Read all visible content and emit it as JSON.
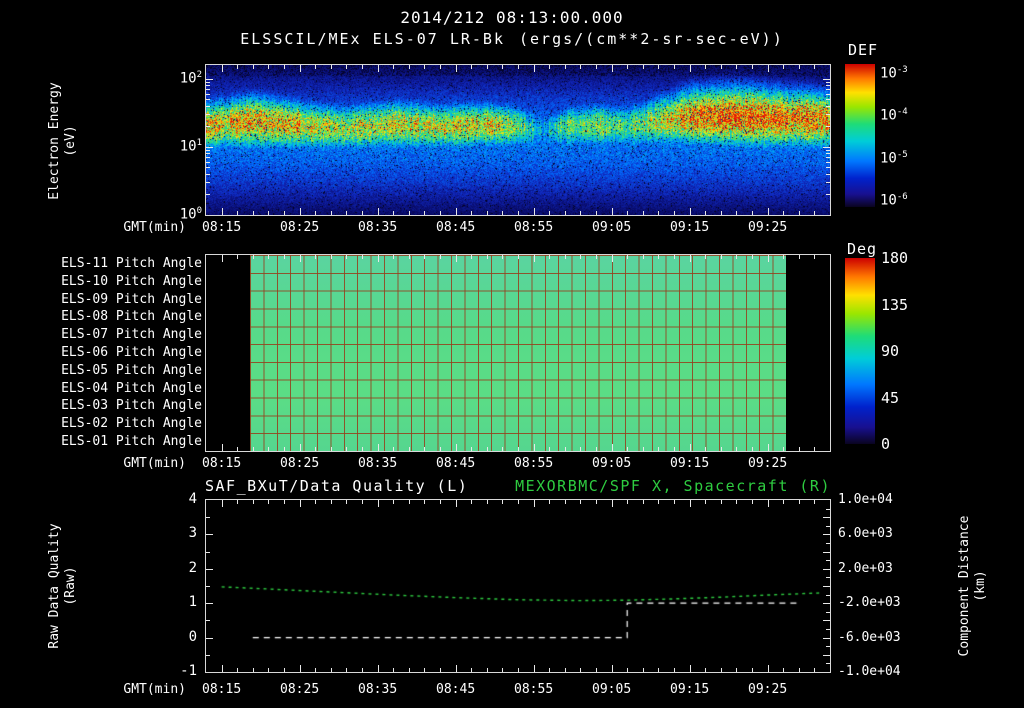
{
  "header": {
    "datetime": "2014/212 08:13:00.000",
    "instrument": "ELSSCIL/MEx ELS-07 LR-Bk",
    "units": "(ergs/(cm**2-sr-sec-eV))"
  },
  "time_axis": {
    "label": "GMT(min)",
    "start": "08:13:00",
    "range_minutes": [
      0,
      80
    ],
    "ticks": [
      {
        "label": "08:15",
        "minute": 2
      },
      {
        "label": "08:25",
        "minute": 12
      },
      {
        "label": "08:35",
        "minute": 22
      },
      {
        "label": "08:45",
        "minute": 32
      },
      {
        "label": "08:55",
        "minute": 42
      },
      {
        "label": "09:05",
        "minute": 52
      },
      {
        "label": "09:15",
        "minute": 62
      },
      {
        "label": "09:25",
        "minute": 72
      }
    ]
  },
  "colors": {
    "background": "#000000",
    "text": "#ffffff",
    "frame": "#d8d8d8",
    "series_green": "#2ecc40",
    "series_white": "#ffffff",
    "pitch_fill": "#57da8a",
    "pitch_grid": "#963e1c"
  },
  "chart_data": [
    {
      "type": "heatmap",
      "name": "electron-energy-spectrogram",
      "title": "ELSSCIL/MEx ELS-07 LR-Bk",
      "units": "ergs/(cm**2-sr-sec-eV)",
      "ylabel": [
        "Electron Energy",
        "(eV)"
      ],
      "y_scale": "log",
      "y_range_eV": [
        1,
        158
      ],
      "y_ticks": [
        {
          "mant": "10",
          "exp": "2"
        },
        {
          "mant": "10",
          "exp": "1"
        },
        {
          "mant": "10",
          "exp": "0"
        }
      ],
      "colorbar": {
        "title": "DEF",
        "min": 1e-06,
        "max": 0.001,
        "ticks": [
          {
            "mant": "10",
            "exp": "-3"
          },
          {
            "mant": "10",
            "exp": "-4"
          },
          {
            "mant": "10",
            "exp": "-5"
          },
          {
            "mant": "10",
            "exp": "-6"
          }
        ]
      },
      "x_minutes_range": [
        0,
        80
      ],
      "background_glow": {
        "level": 0.36,
        "center_logE": 1.1,
        "width_dec": 1.0
      },
      "intensity_profile": [
        [
          0,
          1.32,
          0.38,
          0.78
        ],
        [
          6,
          1.38,
          0.42,
          0.85
        ],
        [
          12,
          1.32,
          0.38,
          0.78
        ],
        [
          18,
          1.28,
          0.36,
          0.72
        ],
        [
          24,
          1.33,
          0.38,
          0.78
        ],
        [
          30,
          1.3,
          0.36,
          0.74
        ],
        [
          36,
          1.32,
          0.36,
          0.76
        ],
        [
          40,
          1.3,
          0.34,
          0.68
        ],
        [
          43,
          1.25,
          0.3,
          0.45
        ],
        [
          46,
          1.3,
          0.34,
          0.6
        ],
        [
          50,
          1.32,
          0.36,
          0.66
        ],
        [
          54,
          1.3,
          0.34,
          0.62
        ],
        [
          58,
          1.38,
          0.4,
          0.72
        ],
        [
          62,
          1.45,
          0.45,
          0.88
        ],
        [
          68,
          1.45,
          0.48,
          0.92
        ],
        [
          74,
          1.42,
          0.46,
          0.88
        ],
        [
          80,
          1.4,
          0.44,
          0.85
        ]
      ],
      "description": "Broad electron flux band near 10-40 eV across the interval; brief dropout near 08:55, brightest yellow-green band after 09:10."
    },
    {
      "type": "heatmap",
      "name": "pitch-angle-panel",
      "rows": [
        "ELS-11 Pitch Angle",
        "ELS-10 Pitch Angle",
        "ELS-09 Pitch Angle",
        "ELS-08 Pitch Angle",
        "ELS-07 Pitch Angle",
        "ELS-06 Pitch Angle",
        "ELS-05 Pitch Angle",
        "ELS-04 Pitch Angle",
        "ELS-03 Pitch Angle",
        "ELS-02 Pitch Angle",
        "ELS-01 Pitch Angle"
      ],
      "value_deg": 95,
      "data_start": "08:19",
      "data_end": "09:27",
      "grid_columns": 40,
      "colorbar": {
        "title": "Deg",
        "ticks": [
          "180",
          "135",
          "90",
          "45",
          "0"
        ],
        "min": 0,
        "max": 180
      }
    },
    {
      "type": "line",
      "name": "quality-and-distance",
      "left_title": "SAF_BXuT/Data Quality (L)",
      "right_title": "MEXORBMC/SPF X, Spacecraft (R)",
      "left_axis": {
        "label": [
          "Raw Data Quality",
          "(Raw)"
        ],
        "ticks": [
          "4",
          "3",
          "2",
          "1",
          "0",
          "-1"
        ],
        "min": -1,
        "max": 4
      },
      "right_axis": {
        "label": [
          "Component Distance",
          "(km)"
        ],
        "ticks": [
          "1.0e+04",
          "6.0e+03",
          "2.0e+03",
          "-2.0e+03",
          "-6.0e+03",
          "-1.0e+04"
        ],
        "min": -10000,
        "max": 10000
      },
      "series": [
        {
          "name": "MEXORBMC/SPF X Spacecraft",
          "axis": "right",
          "color": "#2ecc40",
          "dash": [
            3,
            4
          ],
          "x_minutes": [
            2,
            8,
            16,
            24,
            32,
            40,
            48,
            54,
            60,
            66,
            72,
            79
          ],
          "values_km": [
            -100,
            -350,
            -700,
            -1050,
            -1350,
            -1600,
            -1700,
            -1650,
            -1500,
            -1300,
            -1050,
            -800
          ]
        },
        {
          "name": "SAF_BXuT Data Quality",
          "axis": "left",
          "color": "#ffffff",
          "dash": [
            6,
            5
          ],
          "points": [
            [
              6,
              0
            ],
            [
              54,
              0
            ],
            [
              54,
              1
            ],
            [
              76,
              1
            ]
          ]
        }
      ]
    }
  ]
}
